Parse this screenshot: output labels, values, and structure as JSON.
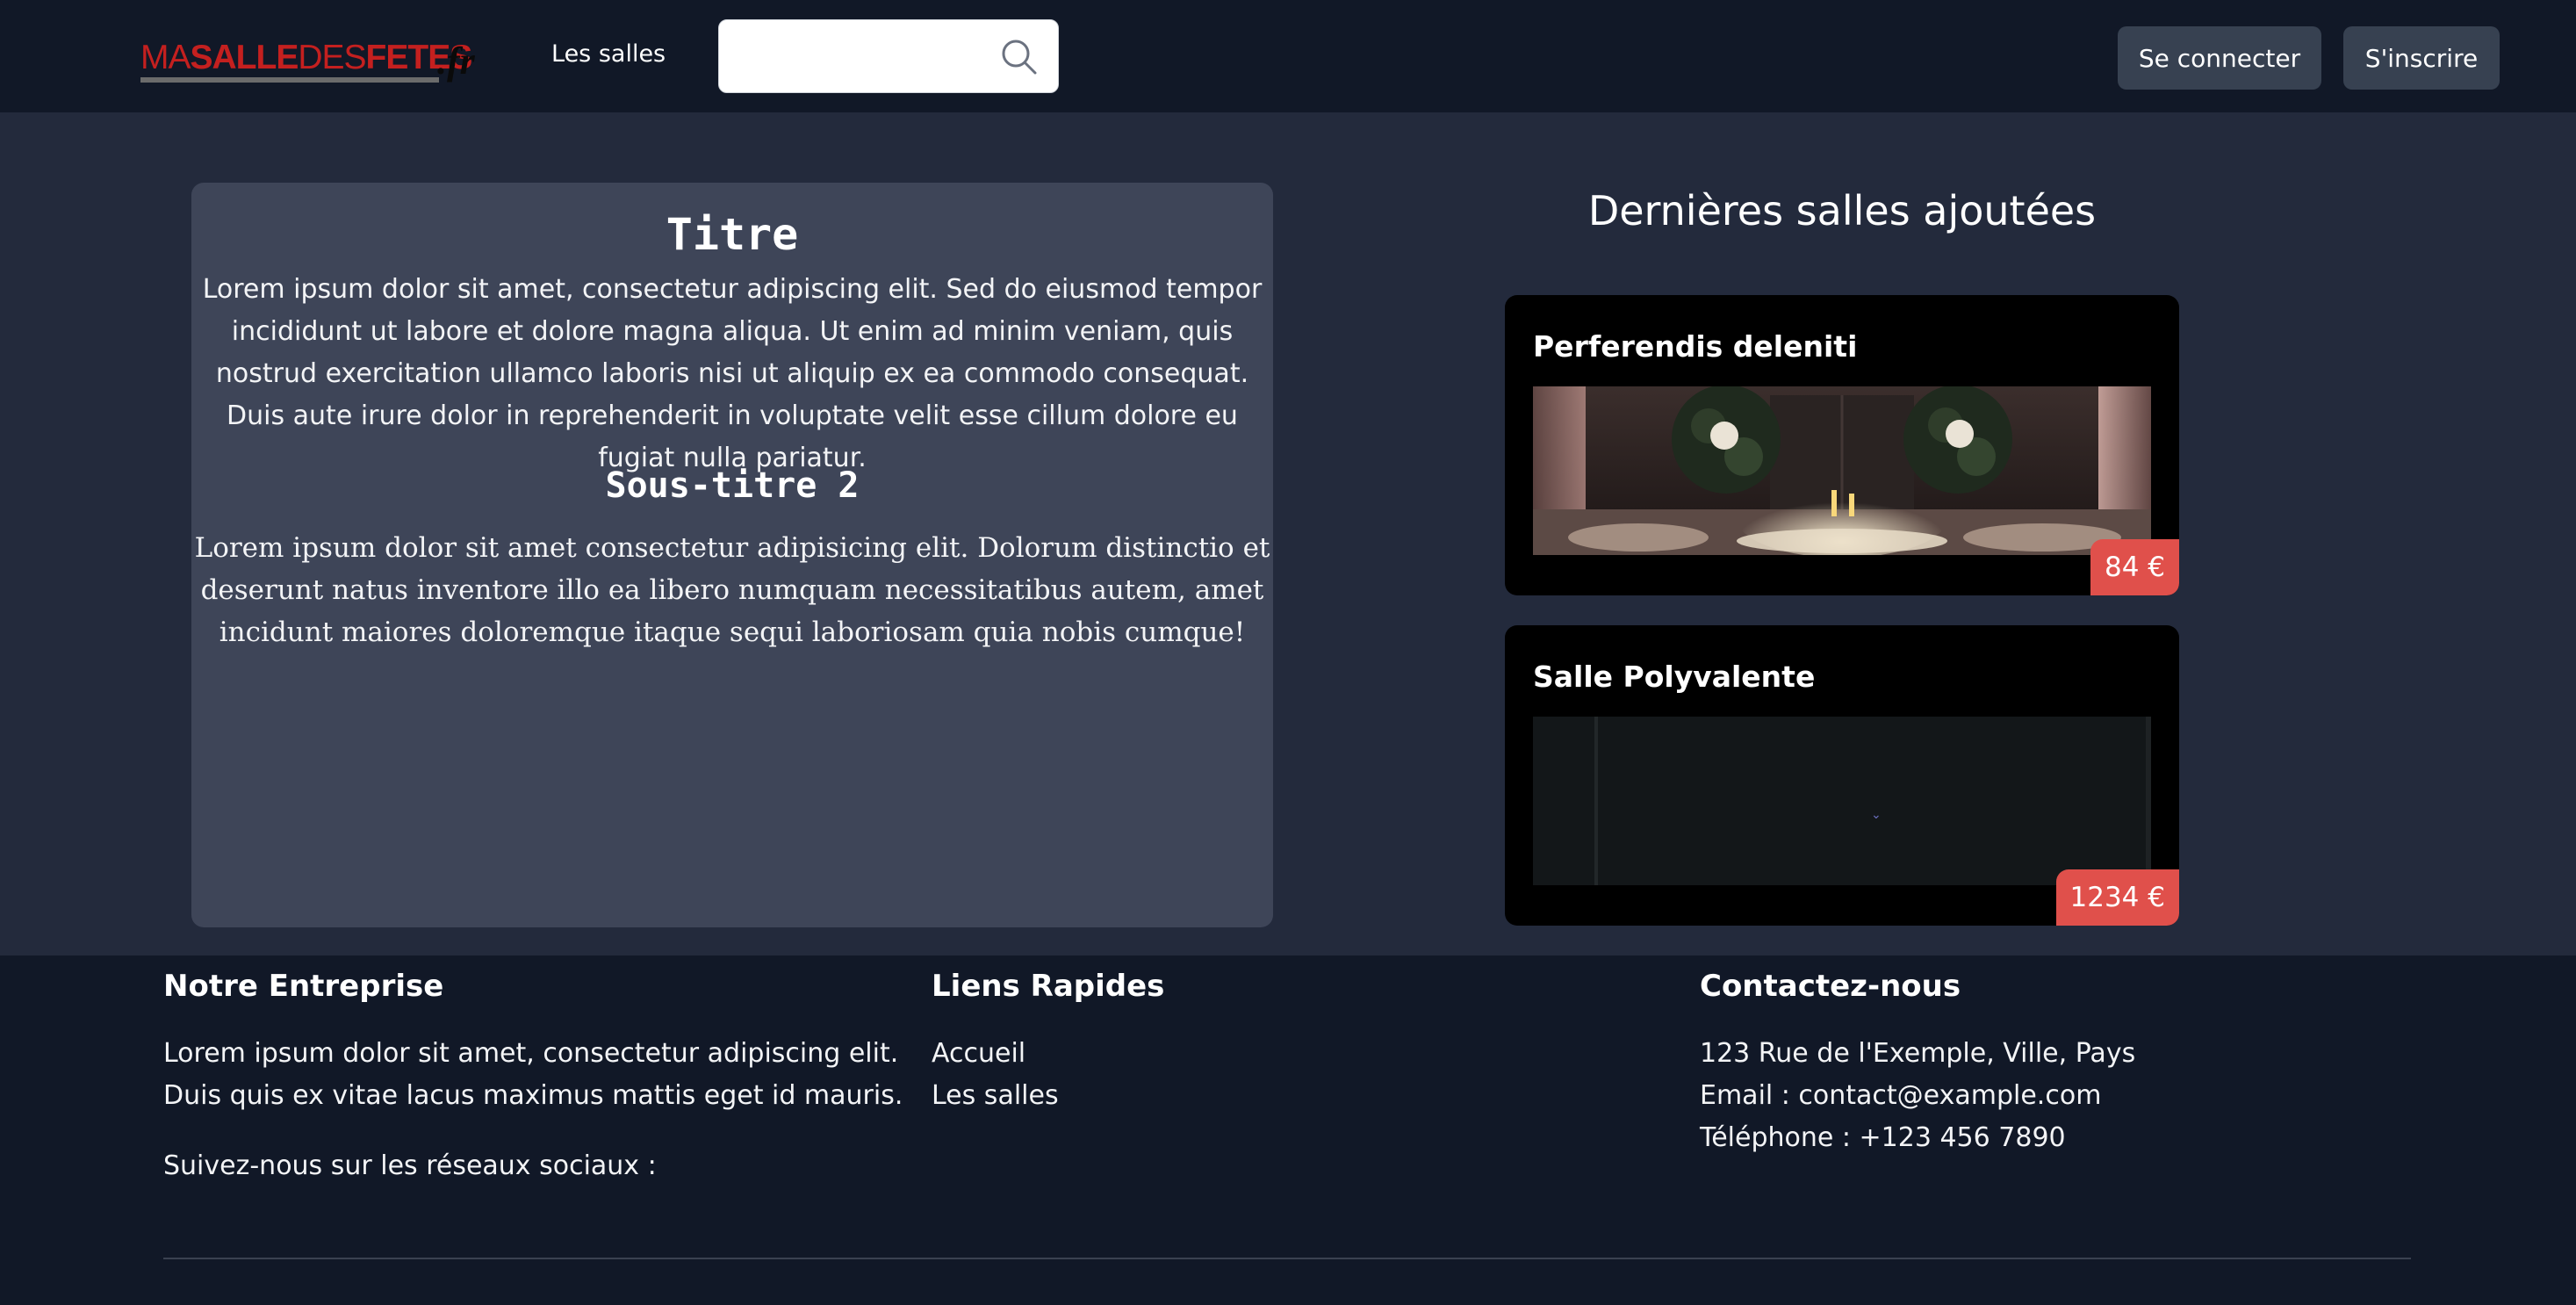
{
  "header": {
    "logo": {
      "part1": "MA",
      "part2": "SALLE",
      "part3": "DES",
      "part4": "FETES",
      "tld": ".fr"
    },
    "nav_link": "Les salles",
    "search": {
      "value": "",
      "placeholder": ""
    },
    "login_label": "Se connecter",
    "signup_label": "S'inscrire"
  },
  "content": {
    "title": "Titre",
    "paragraph1": "Lorem ipsum dolor sit amet, consectetur adipiscing elit. Sed do eiusmod tempor incididunt ut labore et dolore magna aliqua. Ut enim ad minim veniam, quis nostrud exercitation ullamco laboris nisi ut aliquip ex ea commodo consequat. Duis aute irure dolor in reprehenderit in voluptate velit esse cillum dolore eu fugiat nulla pariatur.",
    "subtitle": "Sous-titre 2",
    "paragraph2": "Lorem ipsum dolor sit amet consectetur adipisicing elit. Dolorum distinctio et deserunt natus inventore illo ea libero numquam necessitatibus autem, amet incidunt maiores doloremque itaque sequi laboriosam quia nobis cumque!"
  },
  "latest": {
    "title": "Dernières salles ajoutées",
    "rooms": [
      {
        "name": "Perferendis deleniti",
        "price": "84 €"
      },
      {
        "name": "Salle Polyvalente",
        "price": "1234 €"
      }
    ]
  },
  "footer": {
    "company": {
      "heading": "Notre Entreprise",
      "line1": "Lorem ipsum dolor sit amet, consectetur adipiscing elit.",
      "line2": "Duis quis ex vitae lacus maximus mattis eget id mauris.",
      "social": "Suivez-nous sur les réseaux sociaux :"
    },
    "links": {
      "heading": "Liens Rapides",
      "items": [
        "Accueil",
        "Les salles"
      ]
    },
    "contact": {
      "heading": "Contactez-nous",
      "address": "123 Rue de l'Exemple, Ville, Pays",
      "email": "Email : contact@example.com",
      "phone": "Téléphone : +123 456 7890"
    }
  },
  "colors": {
    "header_bg": "#111827",
    "page_bg": "#232a3c",
    "card_bg": "#3e4558",
    "button_bg": "#374151",
    "price_badge": "#e0504b",
    "logo_red": "#c4201f"
  },
  "icons": {
    "search": "magnifier-icon"
  }
}
